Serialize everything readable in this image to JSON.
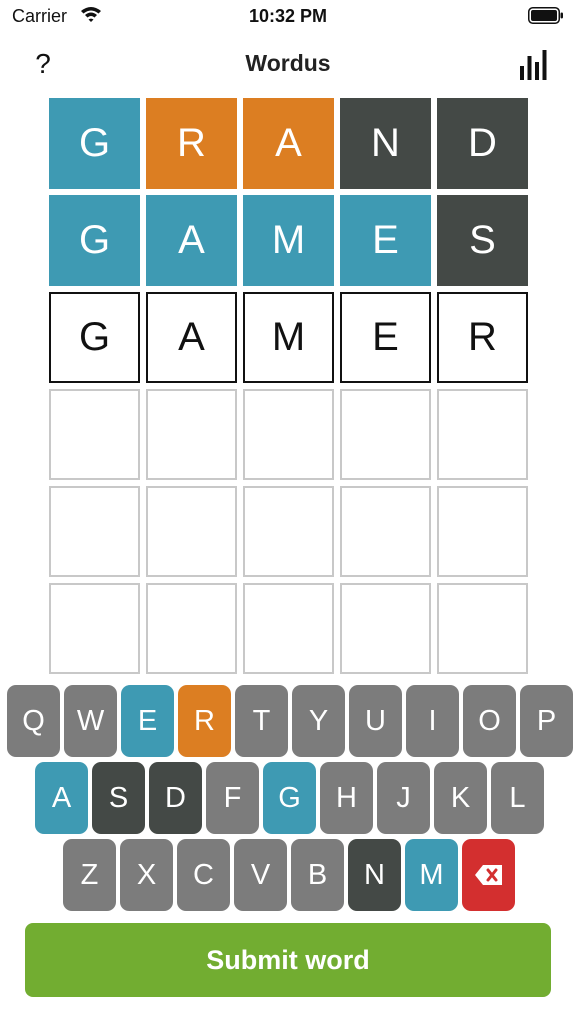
{
  "status_bar": {
    "carrier": "Carrier",
    "time": "10:32 PM"
  },
  "nav": {
    "help_label": "?",
    "title": "Wordus"
  },
  "colors": {
    "correct": "#3e9ab3",
    "present": "#dc7e22",
    "absent": "#444946",
    "key_default": "#7c7c7c",
    "delete": "#d32f2f",
    "submit": "#72ad31"
  },
  "board": {
    "rows": [
      [
        {
          "letter": "G",
          "state": "correct"
        },
        {
          "letter": "R",
          "state": "present"
        },
        {
          "letter": "A",
          "state": "present"
        },
        {
          "letter": "N",
          "state": "absent"
        },
        {
          "letter": "D",
          "state": "absent"
        }
      ],
      [
        {
          "letter": "G",
          "state": "correct"
        },
        {
          "letter": "A",
          "state": "correct"
        },
        {
          "letter": "M",
          "state": "correct"
        },
        {
          "letter": "E",
          "state": "correct"
        },
        {
          "letter": "S",
          "state": "absent"
        }
      ],
      [
        {
          "letter": "G",
          "state": "typed"
        },
        {
          "letter": "A",
          "state": "typed"
        },
        {
          "letter": "M",
          "state": "typed"
        },
        {
          "letter": "E",
          "state": "typed"
        },
        {
          "letter": "R",
          "state": "typed"
        }
      ],
      [
        {
          "letter": "",
          "state": "empty"
        },
        {
          "letter": "",
          "state": "empty"
        },
        {
          "letter": "",
          "state": "empty"
        },
        {
          "letter": "",
          "state": "empty"
        },
        {
          "letter": "",
          "state": "empty"
        }
      ],
      [
        {
          "letter": "",
          "state": "empty"
        },
        {
          "letter": "",
          "state": "empty"
        },
        {
          "letter": "",
          "state": "empty"
        },
        {
          "letter": "",
          "state": "empty"
        },
        {
          "letter": "",
          "state": "empty"
        }
      ],
      [
        {
          "letter": "",
          "state": "empty"
        },
        {
          "letter": "",
          "state": "empty"
        },
        {
          "letter": "",
          "state": "empty"
        },
        {
          "letter": "",
          "state": "empty"
        },
        {
          "letter": "",
          "state": "empty"
        }
      ]
    ]
  },
  "keyboard": {
    "rows": [
      [
        {
          "label": "Q",
          "state": "default"
        },
        {
          "label": "W",
          "state": "default"
        },
        {
          "label": "E",
          "state": "correct"
        },
        {
          "label": "R",
          "state": "present"
        },
        {
          "label": "T",
          "state": "default"
        },
        {
          "label": "Y",
          "state": "default"
        },
        {
          "label": "U",
          "state": "default"
        },
        {
          "label": "I",
          "state": "default"
        },
        {
          "label": "O",
          "state": "default"
        },
        {
          "label": "P",
          "state": "default"
        }
      ],
      [
        {
          "label": "A",
          "state": "correct"
        },
        {
          "label": "S",
          "state": "absent"
        },
        {
          "label": "D",
          "state": "absent"
        },
        {
          "label": "F",
          "state": "default"
        },
        {
          "label": "G",
          "state": "correct"
        },
        {
          "label": "H",
          "state": "default"
        },
        {
          "label": "J",
          "state": "default"
        },
        {
          "label": "K",
          "state": "default"
        },
        {
          "label": "L",
          "state": "default"
        }
      ],
      [
        {
          "label": "Z",
          "state": "default"
        },
        {
          "label": "X",
          "state": "default"
        },
        {
          "label": "C",
          "state": "default"
        },
        {
          "label": "V",
          "state": "default"
        },
        {
          "label": "B",
          "state": "default"
        },
        {
          "label": "N",
          "state": "absent"
        },
        {
          "label": "M",
          "state": "correct"
        },
        {
          "label": "",
          "state": "delete",
          "icon": "backspace-icon"
        }
      ]
    ]
  },
  "submit_label": "Submit word"
}
